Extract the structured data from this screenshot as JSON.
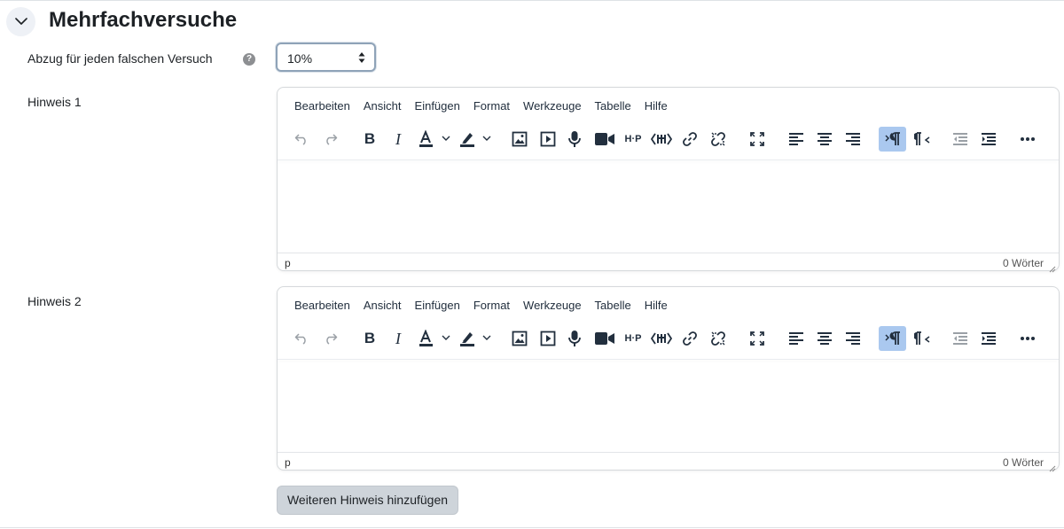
{
  "section": {
    "title": "Mehrfachversuche",
    "toggle_icon": "chevron-down-icon"
  },
  "penalty": {
    "label": "Abzug für jeden falschen Versuch",
    "help_icon": "question-icon",
    "help_glyph": "?",
    "value": "10%"
  },
  "hints": [
    {
      "label": "Hinweis 1",
      "menu": [
        "Bearbeiten",
        "Ansicht",
        "Einfügen",
        "Format",
        "Werkzeuge",
        "Tabelle",
        "Hilfe"
      ],
      "status_path": "p",
      "word_count": "0 Wörter"
    },
    {
      "label": "Hinweis 2",
      "menu": [
        "Bearbeiten",
        "Ansicht",
        "Einfügen",
        "Format",
        "Werkzeuge",
        "Tabelle",
        "Hilfe"
      ],
      "status_path": "p",
      "word_count": "0 Wörter"
    }
  ],
  "toolbar_icons": [
    "undo-icon",
    "redo-icon",
    "bold-icon",
    "italic-icon",
    "text-color-icon",
    "highlight-color-icon",
    "image-icon",
    "media-icon",
    "record-audio-icon",
    "record-video-icon",
    "h5p-icon",
    "html-editor-icon",
    "link-icon",
    "unlink-icon",
    "fullscreen-icon",
    "align-left-icon",
    "align-center-icon",
    "align-right-icon",
    "ltr-icon",
    "rtl-icon",
    "outdent-icon",
    "indent-icon",
    "more-icon"
  ],
  "toolbar_text": {
    "bold": "B",
    "italic": "I",
    "text_color": "A",
    "h5p": "H·P"
  },
  "colors": {
    "accent_active": "#aac8ef",
    "button_gray": "#ced4da",
    "icon_dark": "#222f3e"
  },
  "add_button": "Weiteren Hinweis hinzufügen"
}
